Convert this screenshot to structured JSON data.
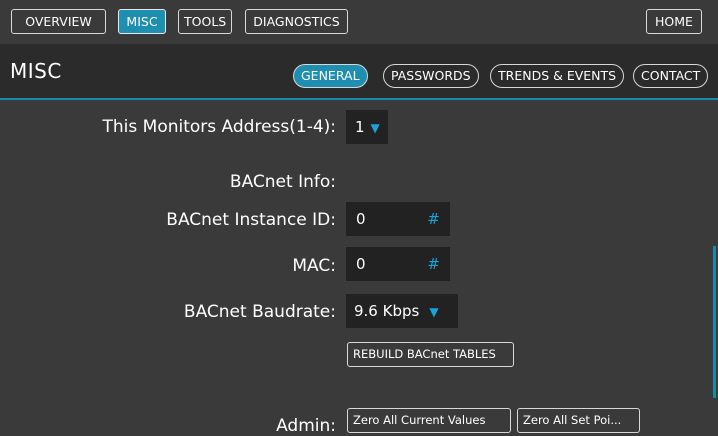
{
  "topnav": {
    "overview": "OVERVIEW",
    "misc": "MISC",
    "tools": "TOOLS",
    "diagnostics": "DIAGNOSTICS",
    "home": "HOME"
  },
  "header": {
    "title": "MISC",
    "tabs": [
      "GENERAL",
      "PASSWORDS",
      "TRENDS & EVENTS",
      "CONTACT"
    ]
  },
  "form": {
    "monitor_address_label": "This Monitors Address(1-4):",
    "monitor_address_value": "1",
    "bacnet_info_label": "BACnet Info:",
    "instance_id_label": "BACnet Instance ID:",
    "instance_id_value": "0",
    "mac_label": "MAC:",
    "mac_value": "0",
    "baudrate_label": "BACnet Baudrate:",
    "baudrate_value": "9.6 Kbps",
    "rebuild_button": "REBUILD BACnet TABLES",
    "admin_label": "Admin:",
    "zero_current_button": "Zero All Current Values",
    "zero_setpoints_button": "Zero All Set Poi..."
  },
  "icons": {
    "dropdown": "▼",
    "numeric": "#"
  },
  "colors": {
    "accent": "#1e8fb0",
    "background": "#3a3a3a",
    "header_bg": "#2b2b2b",
    "field_bg": "#222222"
  }
}
